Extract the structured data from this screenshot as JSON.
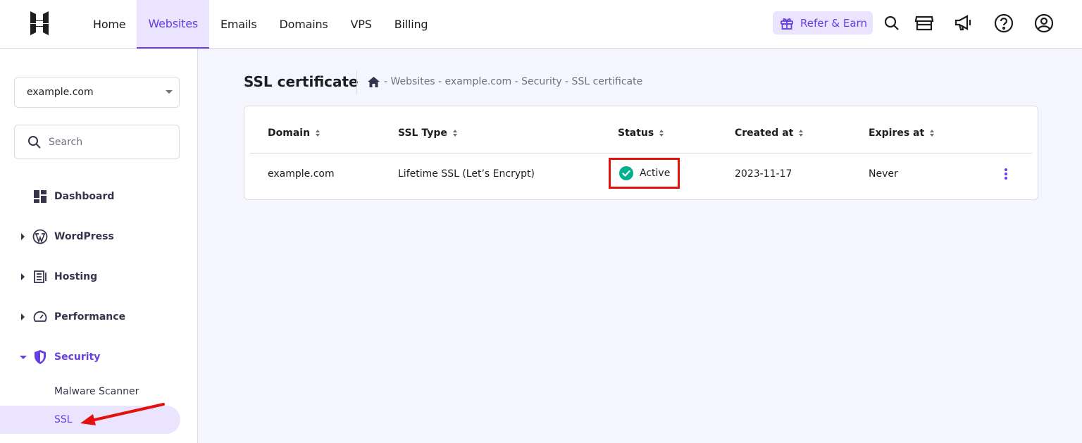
{
  "nav": {
    "items": [
      "Home",
      "Websites",
      "Emails",
      "Domains",
      "VPS",
      "Billing"
    ],
    "active": "Websites",
    "refer_label": "Refer & Earn"
  },
  "sidebar": {
    "domain_select": "example.com",
    "search_placeholder": "Search",
    "menu": [
      {
        "label": "Dashboard",
        "icon": "dashboard-icon"
      },
      {
        "label": "WordPress",
        "icon": "wordpress-icon"
      },
      {
        "label": "Hosting",
        "icon": "hosting-icon"
      },
      {
        "label": "Performance",
        "icon": "gauge-icon"
      },
      {
        "label": "Security",
        "icon": "shield-icon"
      }
    ],
    "submenu": [
      "Malware Scanner",
      "SSL"
    ]
  },
  "main": {
    "title": "SSL certificate",
    "breadcrumb": "- Websites - example.com - Security - SSL certificate",
    "table": {
      "headers": [
        "Domain",
        "SSL Type",
        "Status",
        "Created at",
        "Expires at"
      ],
      "row": {
        "domain": "example.com",
        "ssl_type": "Lifetime SSL (Let’s Encrypt)",
        "status": "Active",
        "created_at": "2023-11-17",
        "expires_at": "Never"
      }
    }
  },
  "colors": {
    "accent": "#673de6",
    "accent_light": "#ebe4ff",
    "success": "#00b090",
    "highlight_red": "#e3100c"
  }
}
